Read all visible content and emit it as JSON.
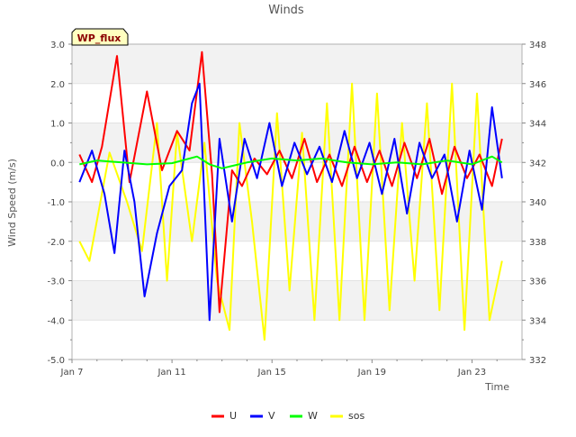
{
  "chart_data": {
    "type": "line",
    "title": "Winds",
    "badge": "WP_flux",
    "xlabel": "Time",
    "ylabel": "Wind Speed (m/s)",
    "ylim": [
      -5.0,
      3.0
    ],
    "y2lim": [
      332,
      348
    ],
    "grid": "horizontal bands",
    "legend_position": "bottom-center",
    "x_ticks": [
      {
        "label": "Jan 7",
        "day": 7
      },
      {
        "label": "Jan 11",
        "day": 11
      },
      {
        "label": "Jan 15",
        "day": 15
      },
      {
        "label": "Jan 19",
        "day": 19
      },
      {
        "label": "Jan 23",
        "day": 23
      }
    ],
    "y_ticks": [
      "3.0",
      "2.0",
      "1.0",
      "0.0",
      "-1.0",
      "-2.0",
      "-3.0",
      "-4.0",
      "-5.0"
    ],
    "y2_ticks": [
      "348",
      "346",
      "344",
      "342",
      "340",
      "338",
      "336",
      "334",
      "332"
    ],
    "series": [
      {
        "name": "U",
        "color": "#ff0000",
        "axis": "left",
        "x": [
          7.3,
          7.8,
          8.2,
          8.8,
          9.3,
          10.0,
          10.6,
          11.2,
          11.7,
          12.2,
          12.6,
          12.9,
          13.4,
          13.8,
          14.3,
          14.8,
          15.3,
          15.8,
          16.3,
          16.8,
          17.3,
          17.8,
          18.3,
          18.8,
          19.3,
          19.8,
          20.3,
          20.8,
          21.3,
          21.8,
          22.3,
          22.8,
          23.3,
          23.8,
          24.2
        ],
        "values": [
          0.2,
          -0.5,
          0.4,
          2.7,
          -0.5,
          1.8,
          -0.2,
          0.8,
          0.3,
          2.8,
          -0.3,
          -3.8,
          -0.2,
          -0.6,
          0.1,
          -0.3,
          0.3,
          -0.4,
          0.6,
          -0.5,
          0.2,
          -0.6,
          0.4,
          -0.5,
          0.3,
          -0.6,
          0.5,
          -0.4,
          0.6,
          -0.8,
          0.4,
          -0.4,
          0.2,
          -0.6,
          0.6
        ]
      },
      {
        "name": "V",
        "color": "#0000ff",
        "axis": "left",
        "x": [
          7.3,
          7.8,
          8.3,
          8.7,
          9.1,
          9.5,
          9.9,
          10.4,
          10.9,
          11.4,
          11.8,
          12.1,
          12.5,
          12.9,
          13.4,
          13.9,
          14.4,
          14.9,
          15.4,
          15.9,
          16.4,
          16.9,
          17.4,
          17.9,
          18.4,
          18.9,
          19.4,
          19.9,
          20.4,
          20.9,
          21.4,
          21.9,
          22.4,
          22.9,
          23.4,
          23.8,
          24.2
        ],
        "values": [
          -0.5,
          0.3,
          -0.8,
          -2.3,
          0.3,
          -1.0,
          -3.4,
          -1.8,
          -0.6,
          -0.2,
          1.5,
          2.0,
          -4.0,
          0.6,
          -1.5,
          0.6,
          -0.4,
          1.0,
          -0.6,
          0.5,
          -0.3,
          0.4,
          -0.5,
          0.8,
          -0.4,
          0.5,
          -0.8,
          0.6,
          -1.3,
          0.5,
          -0.4,
          0.2,
          -1.5,
          0.3,
          -1.2,
          1.4,
          -0.4
        ]
      },
      {
        "name": "W",
        "color": "#00ff00",
        "axis": "left",
        "x": [
          7.3,
          8.0,
          9.0,
          10.0,
          11.0,
          12.0,
          12.5,
          13.0,
          14.0,
          15.0,
          16.0,
          17.0,
          18.0,
          19.0,
          20.0,
          21.0,
          22.0,
          23.0,
          23.8,
          24.2
        ],
        "values": [
          -0.05,
          0.05,
          0.0,
          -0.05,
          -0.02,
          0.15,
          -0.05,
          -0.15,
          0.0,
          0.1,
          0.05,
          0.1,
          0.0,
          -0.05,
          0.0,
          -0.05,
          0.05,
          -0.05,
          0.15,
          0.0
        ]
      },
      {
        "name": "sos",
        "color": "#ffff00",
        "axis": "right",
        "x": [
          7.3,
          7.7,
          8.5,
          9.2,
          9.8,
          10.4,
          10.8,
          11.2,
          11.8,
          12.3,
          12.8,
          13.3,
          13.7,
          14.2,
          14.7,
          15.2,
          15.7,
          16.2,
          16.7,
          17.2,
          17.7,
          18.2,
          18.7,
          19.2,
          19.7,
          20.2,
          20.7,
          21.2,
          21.7,
          22.2,
          22.7,
          23.2,
          23.7,
          24.2
        ],
        "values": [
          338,
          337,
          342.5,
          340,
          337.5,
          344,
          336,
          343.5,
          338,
          343,
          336,
          333.5,
          344,
          339,
          333,
          344.5,
          335.5,
          343.5,
          334,
          345,
          334,
          346,
          334,
          345.5,
          334.5,
          344,
          336,
          345,
          334.5,
          346,
          333.5,
          345.5,
          334,
          337
        ]
      }
    ]
  }
}
